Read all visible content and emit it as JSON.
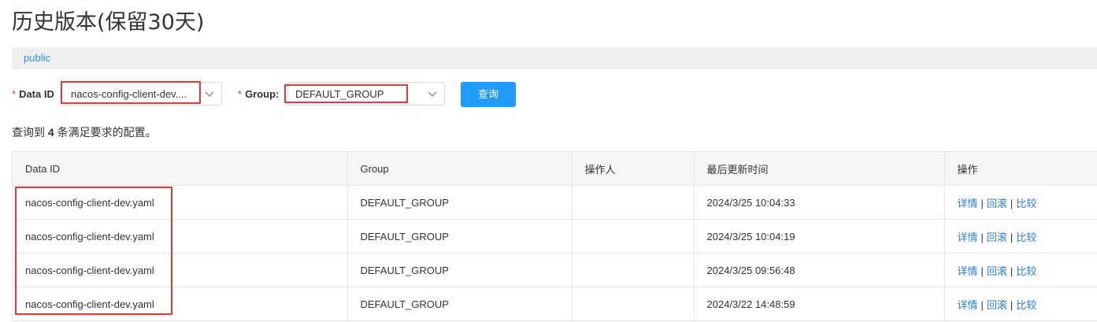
{
  "page": {
    "title": "历史版本(保留30天)"
  },
  "namespace": {
    "current": "public"
  },
  "filters": {
    "data_id": {
      "label": "Data ID",
      "required_mark": "*",
      "value": "nacos-config-client-dev...."
    },
    "group": {
      "label": "Group:",
      "required_mark": "*",
      "value": "DEFAULT_GROUP"
    },
    "query_button": "查询"
  },
  "result": {
    "prefix": "查询到",
    "count": "4",
    "suffix": "条满足要求的配置。"
  },
  "table": {
    "headers": [
      "Data ID",
      "Group",
      "操作人",
      "最后更新时间",
      "操作"
    ],
    "rows": [
      {
        "data_id": "nacos-config-client-dev.yaml",
        "group": "DEFAULT_GROUP",
        "operator": "",
        "updated": "2024/3/25 10:04:33"
      },
      {
        "data_id": "nacos-config-client-dev.yaml",
        "group": "DEFAULT_GROUP",
        "operator": "",
        "updated": "2024/3/25 10:04:19"
      },
      {
        "data_id": "nacos-config-client-dev.yaml",
        "group": "DEFAULT_GROUP",
        "operator": "",
        "updated": "2024/3/25 09:56:48"
      },
      {
        "data_id": "nacos-config-client-dev.yaml",
        "group": "DEFAULT_GROUP",
        "operator": "",
        "updated": "2024/3/22 14:48:59"
      }
    ],
    "actions": {
      "details": "详情",
      "rollback": "回滚",
      "compare": "比较",
      "separator": "|"
    }
  },
  "colors": {
    "primary": "#209bfa",
    "link": "#2b7de0",
    "required": "#f44336",
    "highlight": "#e53935"
  }
}
